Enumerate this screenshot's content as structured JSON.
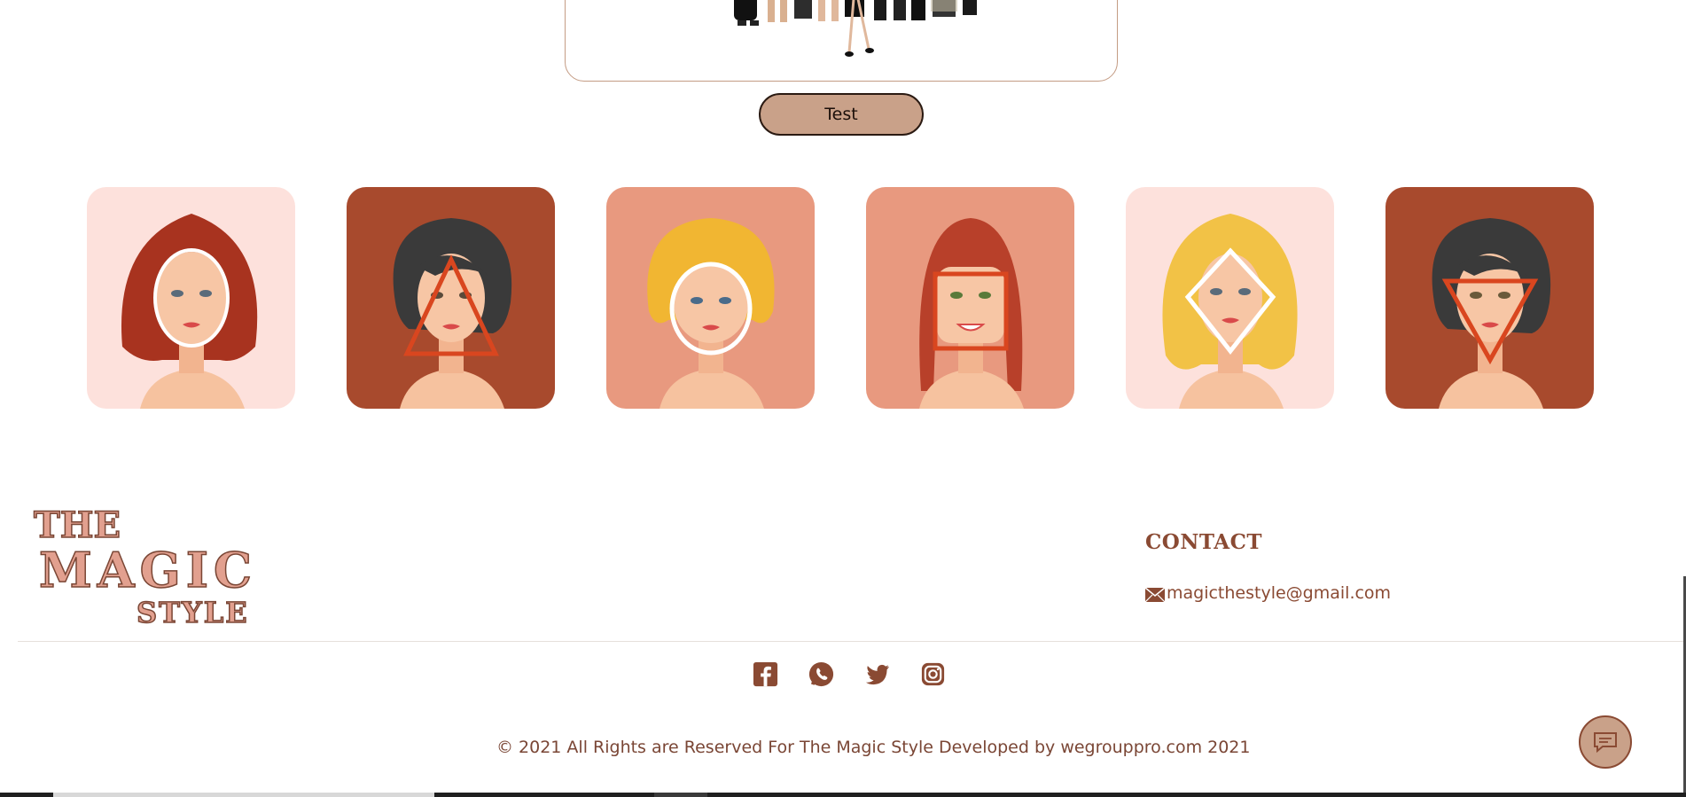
{
  "test_button": {
    "label": "Test"
  },
  "face_shapes": [
    {
      "name": "oval-face",
      "bg": "#fde1dc",
      "hair": "#a8331f",
      "shape": "oval"
    },
    {
      "name": "triangle-face",
      "bg": "#a84a2d",
      "hair": "#3a3a3a",
      "shape": "triangle"
    },
    {
      "name": "round-face",
      "bg": "#e8997f",
      "hair": "#f1b632",
      "shape": "round"
    },
    {
      "name": "square-face",
      "bg": "#e8997f",
      "hair": "#b8402a",
      "shape": "square"
    },
    {
      "name": "diamond-face",
      "bg": "#fde1dc",
      "hair": "#f2c246",
      "shape": "diamond"
    },
    {
      "name": "inverted-triangle-face",
      "bg": "#a84a2d",
      "hair": "#3a3a3a",
      "shape": "inverted-triangle"
    }
  ],
  "footer": {
    "logo": {
      "line1": "THE",
      "line2": "MAGIC",
      "line3": "STYLE"
    },
    "contact_title": "CONTACT",
    "email": "magicthestyle@gmail.com",
    "socials": [
      "facebook-icon",
      "whatsapp-icon",
      "twitter-icon",
      "instagram-icon"
    ],
    "copyright": "© 2021 All Rights are Reserved For The Magic Style Developed by wegrouppro.com 2021"
  },
  "colors": {
    "brand_brown": "#8a4a33",
    "button_tan": "#c9a189",
    "logo_pink": "#e2a08f"
  }
}
